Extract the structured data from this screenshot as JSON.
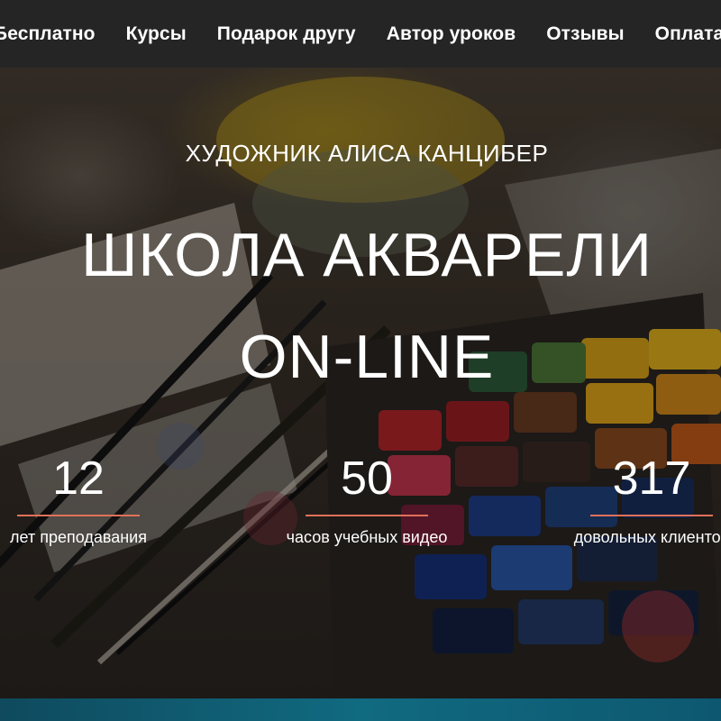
{
  "nav": {
    "items": [
      {
        "label": "Бесплатно"
      },
      {
        "label": "Курсы"
      },
      {
        "label": "Подарок другу"
      },
      {
        "label": "Автор уроков"
      },
      {
        "label": "Отзывы"
      },
      {
        "label": "Оплата"
      }
    ]
  },
  "hero": {
    "subtitle": "ХУДОЖНИК АЛИСА КАНЦИБЕР",
    "title_line1": "ШКОЛА АКВАРЕЛИ",
    "title_line2": "ON-LINE"
  },
  "stats": [
    {
      "number": "12",
      "label": "лет преподавания"
    },
    {
      "number": "50",
      "label": "часов учебных видео"
    },
    {
      "number": "317",
      "label": "довольных клиентов"
    }
  ],
  "colors": {
    "nav_background": "#252525",
    "stat_underline": "#e0715a",
    "bottom_strip": "#106a80"
  }
}
